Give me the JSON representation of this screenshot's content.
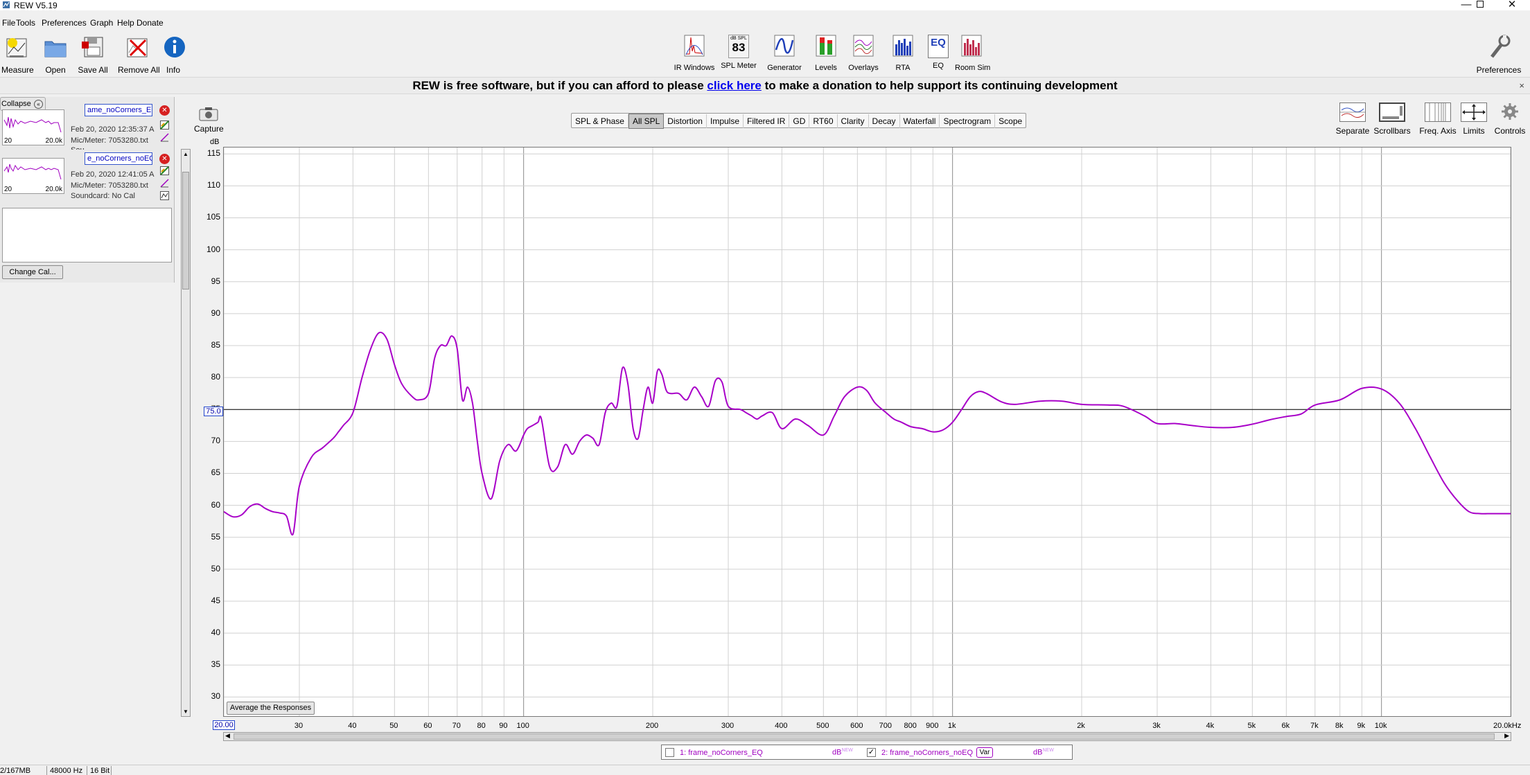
{
  "window": {
    "title": "REW V5.19"
  },
  "menu": [
    "File",
    "Tools",
    "Preferences",
    "Graph",
    "Help",
    "Donate"
  ],
  "toolbar_left": [
    {
      "label": "Measure",
      "icon": "measure-icon"
    },
    {
      "label": "Open",
      "icon": "folder-icon"
    },
    {
      "label": "Save All",
      "icon": "save-all-icon"
    },
    {
      "label": "Remove All",
      "icon": "remove-all-icon"
    },
    {
      "label": "Info",
      "icon": "info-icon"
    }
  ],
  "toolbar_center": [
    {
      "label": "IR Windows",
      "icon": "ir-windows-icon"
    },
    {
      "label": "SPL Meter",
      "icon": "spl-meter-icon",
      "readout_top": "dB SPL",
      "readout_value": "83"
    },
    {
      "label": "Generator",
      "icon": "generator-icon"
    },
    {
      "label": "Levels",
      "icon": "levels-icon"
    },
    {
      "label": "Overlays",
      "icon": "overlays-icon"
    },
    {
      "label": "RTA",
      "icon": "rta-icon"
    },
    {
      "label": "EQ",
      "icon": "eq-icon",
      "text": "EQ"
    },
    {
      "label": "Room Sim",
      "icon": "room-sim-icon"
    }
  ],
  "toolbar_right": {
    "label": "Preferences",
    "icon": "preferences-wrench-icon"
  },
  "banner": {
    "before": "REW is free software, but if you can afford to please",
    "link": "click here",
    "after": "to make a donation to help support its continuing development",
    "close": "×"
  },
  "left_panel": {
    "collapse_label": "Collapse",
    "measurements": [
      {
        "name": "ame_noCorners_EQ",
        "date": "Feb 20, 2020 12:35:37 A",
        "mic": "Mic/Meter: 7053280.txt",
        "soundcard": "Sou",
        "thumb_min": "20",
        "thumb_max": "20.0k"
      },
      {
        "name": "e_noCorners_noEQ",
        "date": "Feb 20, 2020 12:41:05 A",
        "mic": "Mic/Meter: 7053280.txt",
        "soundcard": "Soundcard: No Cal",
        "thumb_min": "20",
        "thumb_max": "20.0k"
      }
    ],
    "change_cal_label": "Change Cal..."
  },
  "capture": {
    "label": "Capture",
    "icon": "camera-icon"
  },
  "tabs": [
    "SPL & Phase",
    "All SPL",
    "Distortion",
    "Impulse",
    "Filtered IR",
    "GD",
    "RT60",
    "Clarity",
    "Decay",
    "Waterfall",
    "Spectrogram",
    "Scope"
  ],
  "active_tab": "All SPL",
  "graph_tools": [
    {
      "label": "Separate",
      "icon": "separate-icon"
    },
    {
      "label": "Scrollbars",
      "icon": "scrollbars-icon"
    },
    {
      "label": "Freq. Axis",
      "icon": "freq-axis-icon"
    },
    {
      "label": "Limits",
      "icon": "limits-icon"
    },
    {
      "label": "Controls",
      "icon": "gear-icon"
    }
  ],
  "avg_button": "Average the Responses",
  "legend": {
    "items": [
      {
        "label": "1: frame_noCorners_EQ",
        "checked": false,
        "unit": "dB",
        "unit_sup": "NEW"
      },
      {
        "label": "2: frame_noCorners_noEQ",
        "checked": true,
        "unit": "dB",
        "unit_sup": "NEW",
        "var": "Var"
      }
    ],
    "check_mark": "✓"
  },
  "status": {
    "memory": "2/167MB",
    "rate": "48000 Hz",
    "bits": "16 Bit"
  },
  "colors": {
    "trace": "#a800c8",
    "grid": "#d0d0d0",
    "grid_major": "#8c8c8c",
    "cursor": "#000000"
  },
  "chart_data": {
    "type": "line",
    "ylabel": "dB",
    "ylim": [
      27,
      116
    ],
    "xlim": [
      20,
      20000
    ],
    "xscale": "log",
    "y_ticks": [
      30,
      35,
      40,
      45,
      50,
      55,
      60,
      65,
      70,
      75,
      80,
      85,
      90,
      95,
      100,
      105,
      110,
      115
    ],
    "x_ticks": [
      "30",
      "40",
      "50",
      "60",
      "70",
      "80",
      "90",
      "100",
      "200",
      "300",
      "400",
      "500",
      "600",
      "700",
      "800",
      "900",
      "1k",
      "2k",
      "3k",
      "4k",
      "5k",
      "6k",
      "7k",
      "8k",
      "9k",
      "10k"
    ],
    "x_min_label": "20.00",
    "x_max_label": "20.0kHz",
    "cursor_level": 75.0,
    "cursor_label": "75.0",
    "grid": true,
    "series": [
      {
        "name": "2: frame_noCorners_noEQ",
        "x": [
          20,
          21,
          22,
          23,
          24,
          25,
          26,
          27,
          28,
          29,
          30,
          32,
          34,
          36,
          37,
          38,
          40,
          42,
          44,
          46,
          48,
          50,
          52,
          55,
          57,
          60,
          62,
          64,
          66,
          68,
          70,
          72,
          74,
          76,
          78,
          80,
          84,
          88,
          92,
          96,
          100,
          102,
          105,
          108,
          110,
          115,
          120,
          125,
          130,
          135,
          140,
          145,
          150,
          155,
          160,
          165,
          170,
          175,
          180,
          185,
          190,
          195,
          200,
          205,
          210,
          215,
          220,
          230,
          240,
          250,
          260,
          270,
          280,
          290,
          300,
          320,
          330,
          340,
          350,
          360,
          380,
          400,
          430,
          460,
          500,
          530,
          560,
          600,
          630,
          660,
          700,
          730,
          760,
          800,
          850,
          900,
          950,
          1000,
          1050,
          1100,
          1150,
          1200,
          1300,
          1400,
          1600,
          1800,
          2000,
          2300,
          2500,
          2800,
          3000,
          3300,
          3600,
          4000,
          4500,
          5000,
          5500,
          6000,
          6500,
          7000,
          8000,
          9000,
          10000,
          11000,
          12000,
          13000,
          14000,
          15000,
          16000,
          17000,
          18000,
          19000,
          20000
        ],
        "y": [
          59,
          58.2,
          58.5,
          59.8,
          60.2,
          59.5,
          59,
          58.8,
          58.3,
          55.5,
          63,
          67.5,
          69,
          70.5,
          71.5,
          72.5,
          74.5,
          80,
          84.5,
          87,
          86,
          82,
          79,
          77,
          76.5,
          77.5,
          83,
          85,
          85,
          86.5,
          84.5,
          76.5,
          78.5,
          76,
          70,
          65,
          61,
          67,
          69.5,
          68.5,
          71,
          72,
          72.5,
          73,
          73.5,
          66,
          66,
          69.5,
          68,
          70,
          71,
          70.5,
          69.5,
          74.5,
          76,
          75.5,
          81.5,
          79,
          72,
          70.5,
          75,
          78.5,
          76,
          81,
          80.5,
          78,
          77.5,
          77.5,
          76.5,
          78.5,
          77,
          75.5,
          79.5,
          79.3,
          75.5,
          75,
          74.5,
          74,
          73.5,
          74,
          74.5,
          72,
          73.5,
          72.5,
          71,
          74,
          77,
          78.5,
          78,
          76,
          74.5,
          73.5,
          73,
          72.3,
          72,
          71.5,
          71.8,
          73,
          75,
          77,
          77.8,
          77.5,
          76.2,
          75.8,
          76.3,
          76.3,
          75.8,
          75.7,
          75.5,
          74,
          72.8,
          72.8,
          72.5,
          72.2,
          72.2,
          72.7,
          73.4,
          73.9,
          74.3,
          75.7,
          76.5,
          78.3,
          78.2,
          76,
          72,
          67.5,
          63.5,
          60.8,
          59,
          58.7,
          58.7,
          58.7,
          58.7
        ]
      }
    ]
  }
}
